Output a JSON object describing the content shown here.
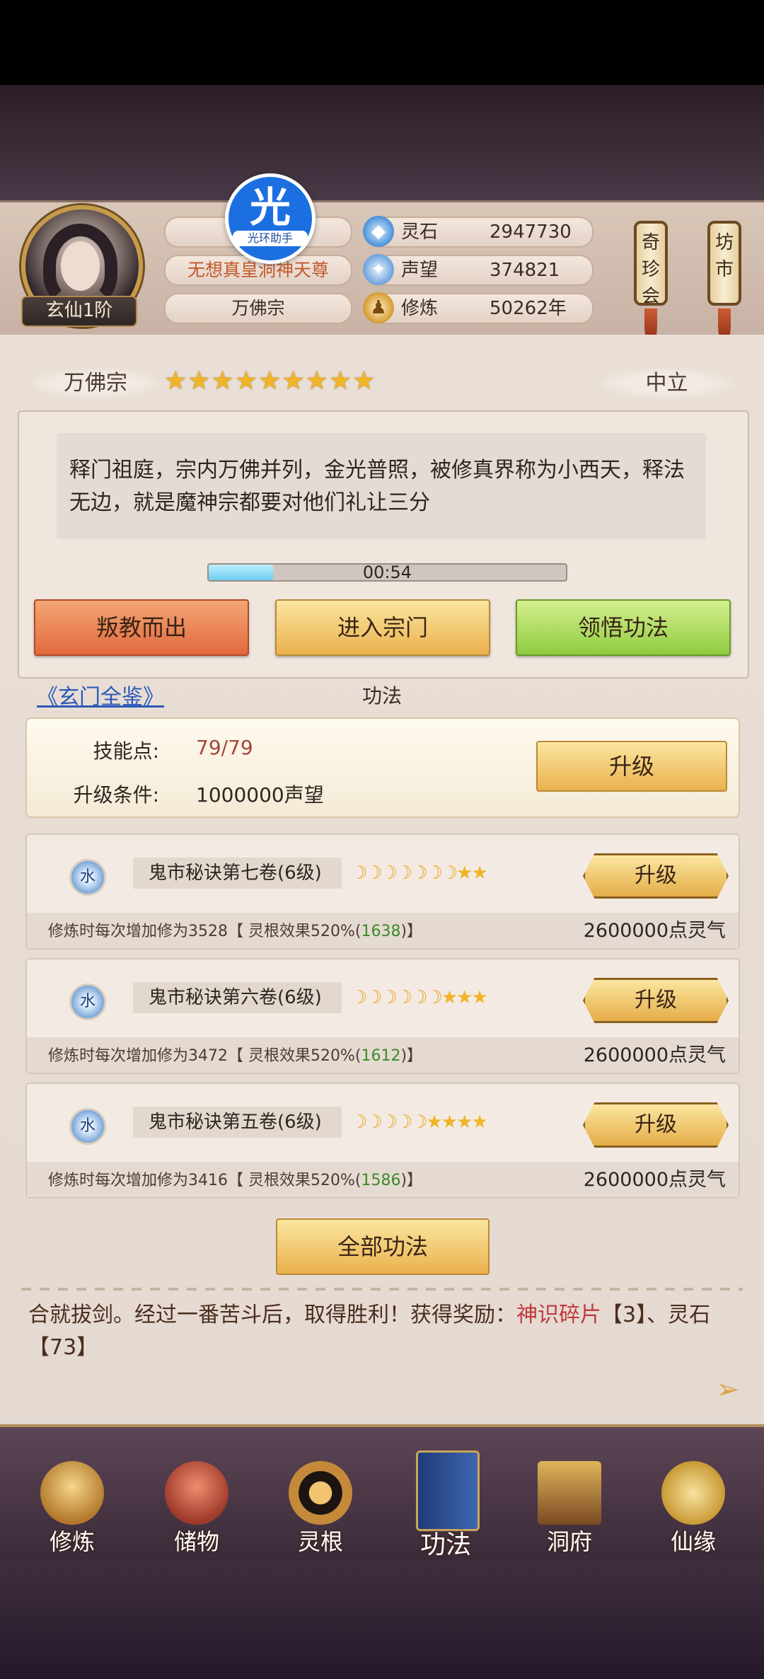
{
  "header": {
    "rank": "玄仙1阶",
    "helper_badge": {
      "glyph": "光",
      "label": "光环助手"
    },
    "title_line": "无想真皇洞神天尊",
    "sect_line": "万佛宗",
    "resources": [
      {
        "icon": "spirit-stone-icon",
        "label": "灵石",
        "value": "2947730"
      },
      {
        "icon": "reputation-icon",
        "label": "声望",
        "value": "374821"
      },
      {
        "icon": "meditation-icon",
        "label": "修炼",
        "value": "50262年"
      }
    ],
    "scrolls": [
      "奇珍会",
      "坊市"
    ]
  },
  "sect": {
    "name": "万佛宗",
    "stars": "★★★★★★★★★",
    "stance": "中立",
    "description": "释门祖庭，宗内万佛并列，金光普照，被修真界称为小西天，释法无边，就是魔神宗都要对他们礼让三分",
    "timer": "00:54",
    "timer_progress_fraction": 0.18,
    "buttons": {
      "leave": "叛教而出",
      "enter": "进入宗门",
      "learn": "领悟功法"
    }
  },
  "gongfa": {
    "link": "《玄门全鉴》",
    "title": "功法",
    "skill_points_label": "技能点:",
    "skill_points_value": "79/79",
    "upgrade_cond_label": "升级条件:",
    "upgrade_cond_value": "1000000声望",
    "upgrade_label": "升级",
    "techniques": [
      {
        "element": "水",
        "name": "鬼市秘诀第七卷(6级)",
        "moons": "☽☽☽☽☽☽☽",
        "stars": "★★",
        "upgrade": "升级",
        "info_prefix": "修炼时每次增加修为3528【 灵根效果520%(",
        "info_bonus": "1638",
        "info_suffix": ")】",
        "cost": "2600000点灵气"
      },
      {
        "element": "水",
        "name": "鬼市秘诀第六卷(6级)",
        "moons": "☽☽☽☽☽☽",
        "stars": "★★★",
        "upgrade": "升级",
        "info_prefix": "修炼时每次增加修为3472【 灵根效果520%(",
        "info_bonus": "1612",
        "info_suffix": ")】",
        "cost": "2600000点灵气"
      },
      {
        "element": "水",
        "name": "鬼市秘诀第五卷(6级)",
        "moons": "☽☽☽☽☽",
        "stars": "★★★★",
        "upgrade": "升级",
        "info_prefix": "修炼时每次增加修为3416【 灵根效果520%(",
        "info_bonus": "1586",
        "info_suffix": ")】",
        "cost": "2600000点灵气"
      }
    ],
    "all_button": "全部功法"
  },
  "log": {
    "text1": "合就拔剑。经过一番苦斗后，取得胜利！获得奖励：",
    "reward1": "神识碎片",
    "text2": "【3】、灵石【73】"
  },
  "nav": [
    "修炼",
    "储物",
    "灵根",
    "功法",
    "洞府",
    "仙缘"
  ],
  "colors": {
    "accent_gold": "#eab14d",
    "red_button": "#e3683e",
    "green_button": "#8fcc40",
    "link_blue": "#2a5ab8",
    "highlight_red": "#c13a3a"
  }
}
